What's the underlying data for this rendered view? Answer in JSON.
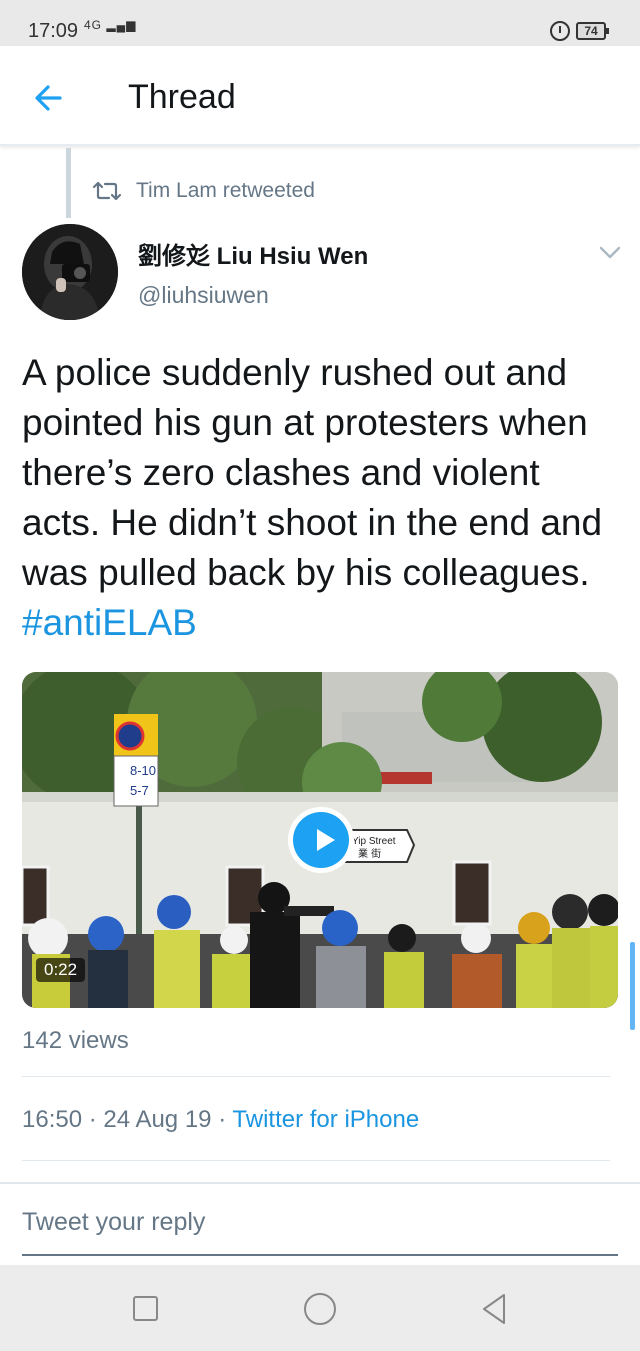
{
  "status_bar": {
    "time": "17:09",
    "signal": "4G",
    "battery": "74"
  },
  "header": {
    "title": "Thread"
  },
  "tweet": {
    "retweeted_by": "Tim Lam retweeted",
    "author_name": "劉修彣 Liu Hsiu Wen",
    "author_handle": "@liuhsiuwen",
    "text": "A police suddenly rushed out and pointed his gun at protesters when there’s zero clashes and violent acts. He didn’t shoot in the end and was pulled back by his colleagues. ",
    "hashtag": "#antiELAB",
    "video": {
      "duration": "0:22",
      "sign_top": "8-10",
      "sign_bottom": "5-7",
      "street_sign": "Yip Street",
      "street_sign_cn": "業 街"
    },
    "views": "142 views",
    "time": "16:50",
    "date": "24 Aug 19",
    "separator": "·",
    "client": "Twitter for iPhone"
  },
  "reply": {
    "placeholder": "Tweet your reply"
  },
  "colors": {
    "link_blue": "#1b95e0",
    "play_blue": "#1da1f2",
    "secondary_text": "#657786"
  }
}
